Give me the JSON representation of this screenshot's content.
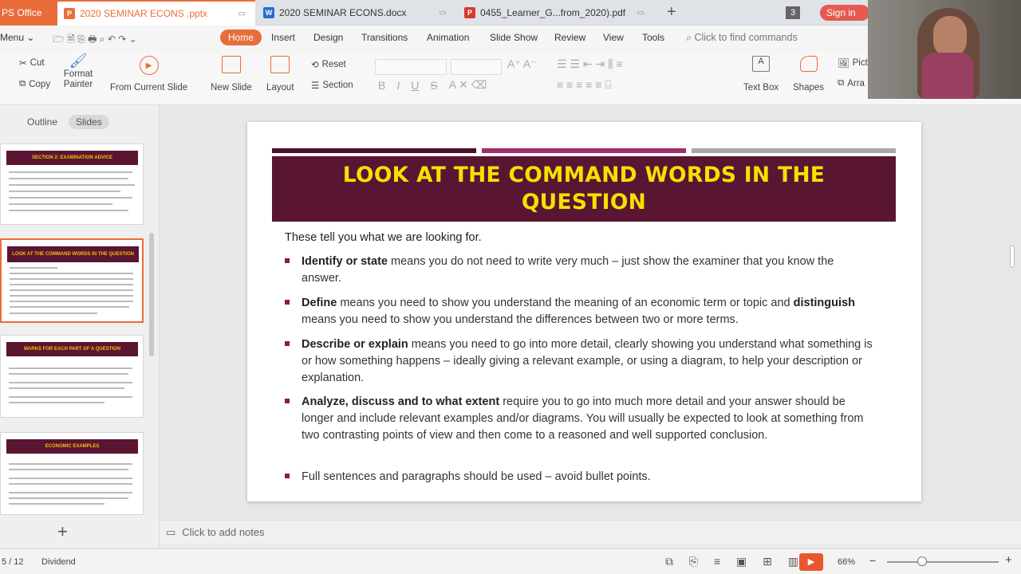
{
  "tabbar": {
    "app_label": "PS Office",
    "tabs": [
      {
        "label": "2020 SEMINAR ECONS .pptx",
        "icon": "presentation-file-icon",
        "active": true
      },
      {
        "label": "2020 SEMINAR ECONS.docx",
        "icon": "writer-file-icon",
        "active": false
      },
      {
        "label": "0455_Learner_G...from_2020).pdf",
        "icon": "pdf-file-icon",
        "active": false
      }
    ],
    "window_count": "3",
    "sign_in": "Sign in"
  },
  "menubar": {
    "menu": "Menu",
    "tabs": [
      "Home",
      "Insert",
      "Design",
      "Transitions",
      "Animation",
      "Slide Show",
      "Review",
      "View",
      "Tools"
    ],
    "search_placeholder": "Click to find commands"
  },
  "ribbon": {
    "cut": "Cut",
    "copy": "Copy",
    "format_painter": "Format Painter",
    "from_current_slide": "From Current Slide",
    "new_slide": "New Slide",
    "layout": "Layout",
    "reset": "Reset",
    "section": "Section",
    "text_box": "Text Box",
    "shapes": "Shapes",
    "picture": "Pict",
    "arrange": "Arra"
  },
  "leftpane": {
    "view_tabs": [
      "Outline",
      "Slides"
    ],
    "thumbnails": [
      {
        "title": "SECTION 2: EXAMINATION ADVICE"
      },
      {
        "title": "LOOK AT THE COMMAND WORDS IN THE QUESTION"
      },
      {
        "title": "MARKS FOR EACH PART OF A QUESTION"
      },
      {
        "title": "ECONOMIC EXAMPLES"
      }
    ]
  },
  "slide": {
    "title": "LOOK AT THE COMMAND WORDS IN THE QUESTION",
    "intro": "These tell you what we are looking for.",
    "bullets": [
      {
        "bold": "Identify or state",
        "text": " means you do not need to write very much – just show the examiner that you know the answer."
      },
      {
        "bold": "Define",
        "text": " means you need to show you understand the meaning of an economic term or topic and ",
        "bold2": "distinguish",
        "text2": " means you need to show you understand the differences between two or more terms."
      },
      {
        "bold": "Describe or explain",
        "text": " means you need to go into more detail, clearly showing you understand what something is or how something happens – ideally giving a relevant example, or using a diagram, to help your description or explanation."
      },
      {
        "bold": "Analyze, discuss and to what extent",
        "text": " require you to go into much more detail and your answer should be longer and include relevant examples and/or diagrams. You will usually be expected to look at something from two contrasting points of view and then come to a reasoned and well supported conclusion."
      },
      {
        "bold": "",
        "text": "Full sentences and paragraphs should be used – avoid bullet points."
      }
    ],
    "colors": {
      "band": "#5a1533",
      "title": "#f5e100",
      "bar1": "#4a1028",
      "bar2": "#a0306a",
      "bar3": "#a8a8a8"
    }
  },
  "notes_placeholder": "Click to add notes",
  "status": {
    "slide_counter": "5 / 12",
    "theme": "Dividend",
    "zoom": "66%"
  }
}
